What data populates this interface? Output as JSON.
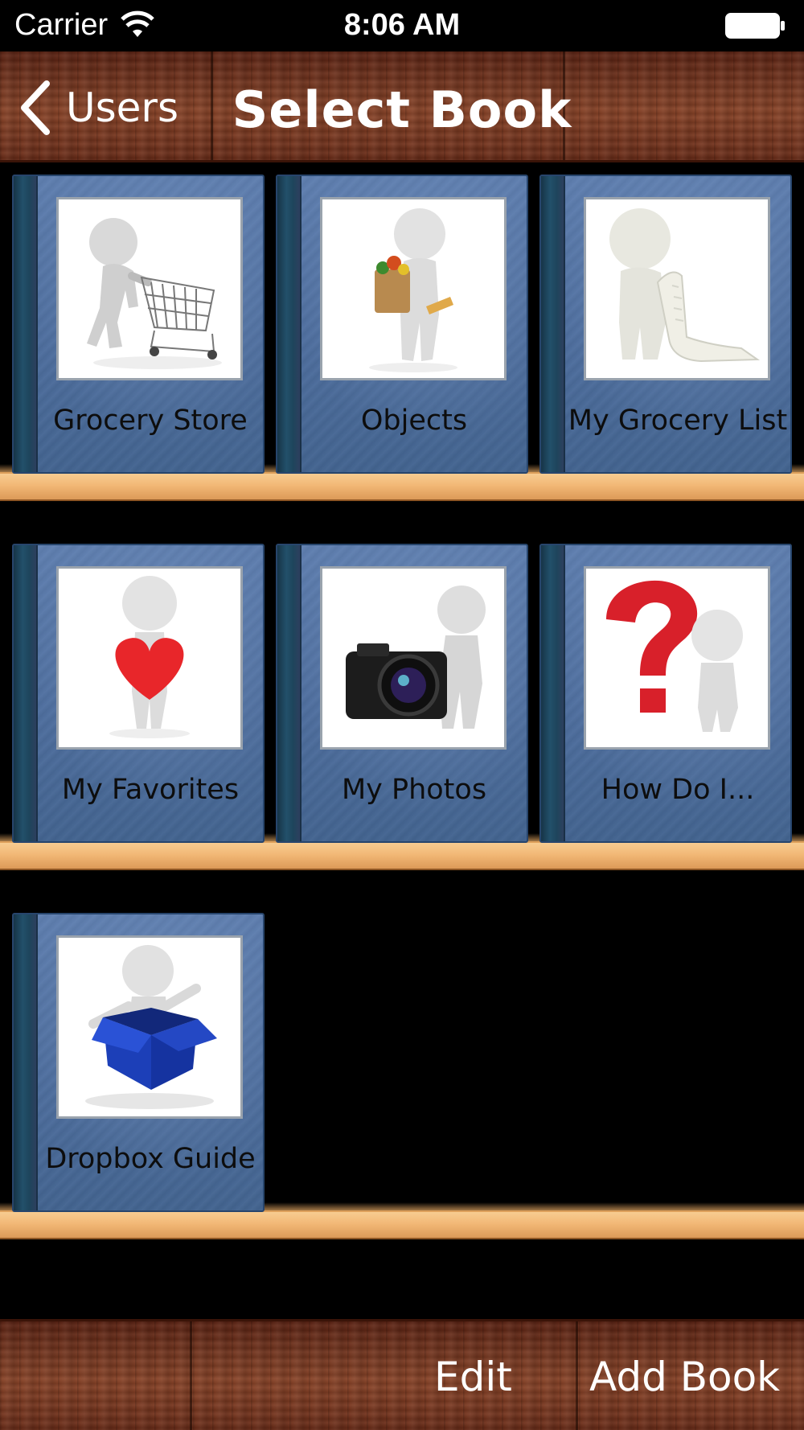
{
  "status_bar": {
    "carrier": "Carrier",
    "time": "8:06 AM",
    "wifi_icon": "wifi-icon",
    "battery_icon": "battery-icon"
  },
  "nav_bar": {
    "back_label": "Users",
    "back_icon": "chevron-left-icon",
    "title": "Select Book"
  },
  "books": [
    {
      "label": "Grocery Store",
      "icon": "person-with-cart-icon"
    },
    {
      "label": "Objects",
      "icon": "person-with-grocery-bag-icon"
    },
    {
      "label": "My Grocery List",
      "icon": "person-with-list-scroll-icon"
    },
    {
      "label": "My Favorites",
      "icon": "person-with-heart-icon"
    },
    {
      "label": "My Photos",
      "icon": "person-with-camera-icon"
    },
    {
      "label": "How Do I...",
      "icon": "person-with-question-mark-icon"
    },
    {
      "label": "Dropbox Guide",
      "icon": "person-in-box-icon"
    }
  ],
  "toolbar": {
    "edit_label": "Edit",
    "add_book_label": "Add Book"
  },
  "colors": {
    "wood": "#7a3a22",
    "book_blue": "#4f6f9f",
    "shelf": "#f2b876",
    "question_red": "#d8202a",
    "box_blue": "#1c3fb8"
  }
}
